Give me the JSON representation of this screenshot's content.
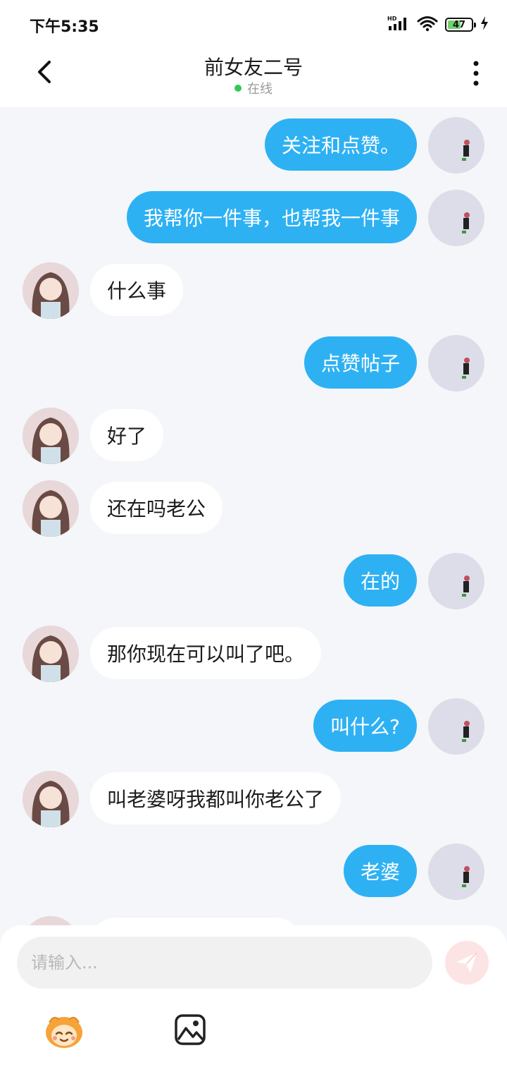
{
  "status_bar": {
    "time": "下午5:35",
    "battery_level": "47",
    "network": "HD"
  },
  "header": {
    "title": "前女友二号",
    "status": "在线"
  },
  "messages": [
    {
      "side": "sent",
      "text": "关注和点赞。"
    },
    {
      "side": "sent",
      "text": "我帮你一件事，也帮我一件事"
    },
    {
      "side": "recv",
      "text": "什么事"
    },
    {
      "side": "sent",
      "text": "点赞帖子"
    },
    {
      "side": "recv",
      "text": "好了"
    },
    {
      "side": "recv",
      "text": "还在吗老公"
    },
    {
      "side": "sent",
      "text": "在的"
    },
    {
      "side": "recv",
      "text": "那你现在可以叫了吧。"
    },
    {
      "side": "sent",
      "text": "叫什么?"
    },
    {
      "side": "recv",
      "text": "叫老婆呀我都叫你老公了"
    },
    {
      "side": "sent",
      "text": "老婆"
    },
    {
      "side": "recv",
      "text": ""
    }
  ],
  "input": {
    "placeholder": "请输入..."
  },
  "colors": {
    "sent_bubble": "#2eb1f3",
    "online": "#34c759",
    "send_button_bg": "#fde4e4"
  },
  "icons": [
    "back-arrow-icon",
    "more-vertical-icon",
    "send-icon",
    "emoji-icon",
    "image-icon",
    "wifi-icon",
    "signal-icon",
    "battery-icon",
    "charging-icon"
  ]
}
